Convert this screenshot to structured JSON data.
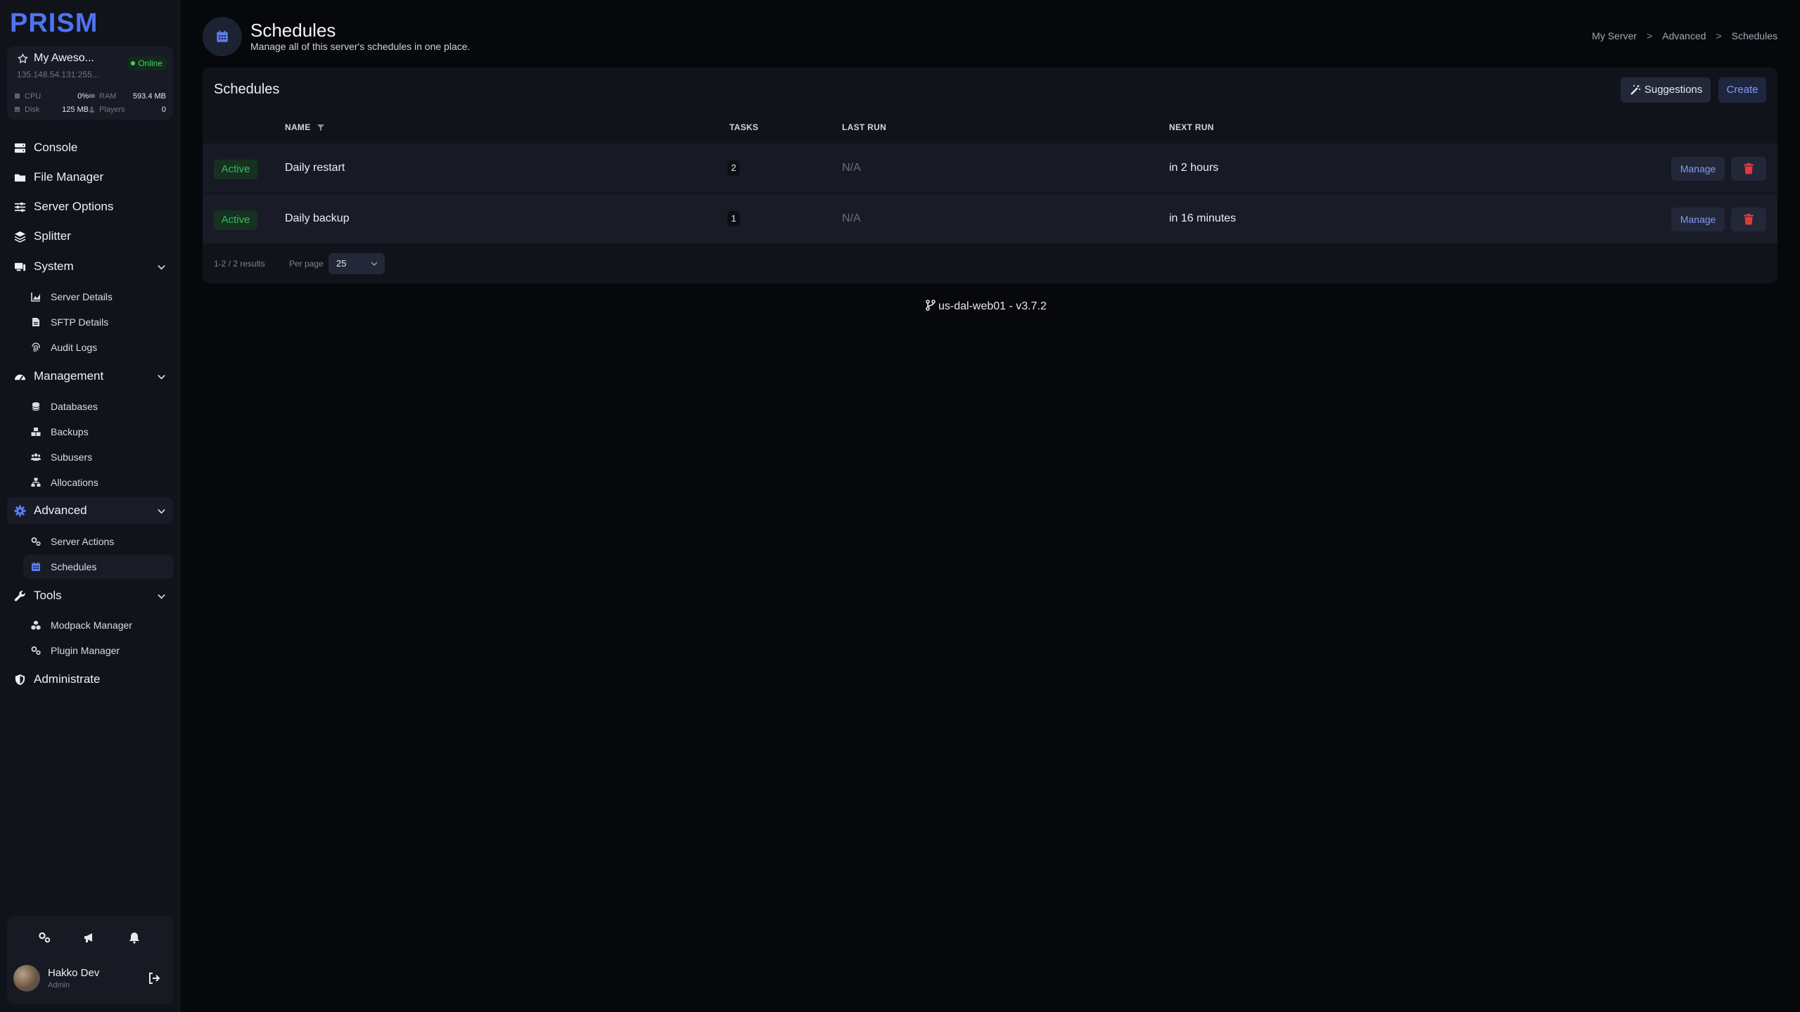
{
  "brand": {
    "logo_text": "PRISM",
    "accent": "#4f73f0"
  },
  "server": {
    "name": "My Aweso...",
    "status": "Online",
    "ip": "135.148.54.131:255...",
    "stats": {
      "cpu_label": "CPU",
      "cpu_value": "0%",
      "ram_label": "RAM",
      "ram_value": "593.4 MB",
      "disk_label": "Disk",
      "disk_value": "125 MB",
      "players_label": "Players",
      "players_value": "0"
    }
  },
  "nav": {
    "console": "Console",
    "file_manager": "File Manager",
    "server_options": "Server Options",
    "splitter": "Splitter",
    "system": "System",
    "server_details": "Server Details",
    "sftp_details": "SFTP Details",
    "audit_logs": "Audit Logs",
    "management": "Management",
    "databases": "Databases",
    "backups": "Backups",
    "subusers": "Subusers",
    "allocations": "Allocations",
    "advanced": "Advanced",
    "server_actions": "Server Actions",
    "schedules": "Schedules",
    "tools": "Tools",
    "modpack_manager": "Modpack Manager",
    "plugin_manager": "Plugin Manager",
    "administrate": "Administrate"
  },
  "user": {
    "name": "Hakko Dev",
    "role": "Admin"
  },
  "header": {
    "title": "Schedules",
    "subtitle": "Manage all of this server's schedules in one place.",
    "breadcrumb": [
      "My Server",
      "Advanced",
      "Schedules"
    ],
    "breadcrumb_sep": ">"
  },
  "panel": {
    "title": "Schedules",
    "suggestions_label": "Suggestions",
    "create_label": "Create",
    "columns": {
      "name": "NAME",
      "tasks": "TASKS",
      "last_run": "LAST RUN",
      "next_run": "NEXT RUN"
    },
    "rows": [
      {
        "status": "Active",
        "name": "Daily restart",
        "tasks": "2",
        "last_run": "N/A",
        "next_run": "in 2 hours",
        "manage": "Manage"
      },
      {
        "status": "Active",
        "name": "Daily backup",
        "tasks": "1",
        "last_run": "N/A",
        "next_run": "in 16 minutes",
        "manage": "Manage"
      }
    ],
    "pagination": {
      "range": "1-2",
      "sep": "/",
      "results": "2 results",
      "per_page_label": "Per page",
      "per_page_value": "25"
    }
  },
  "footer": {
    "node": "us-dal-web01 - v3.7.2"
  }
}
